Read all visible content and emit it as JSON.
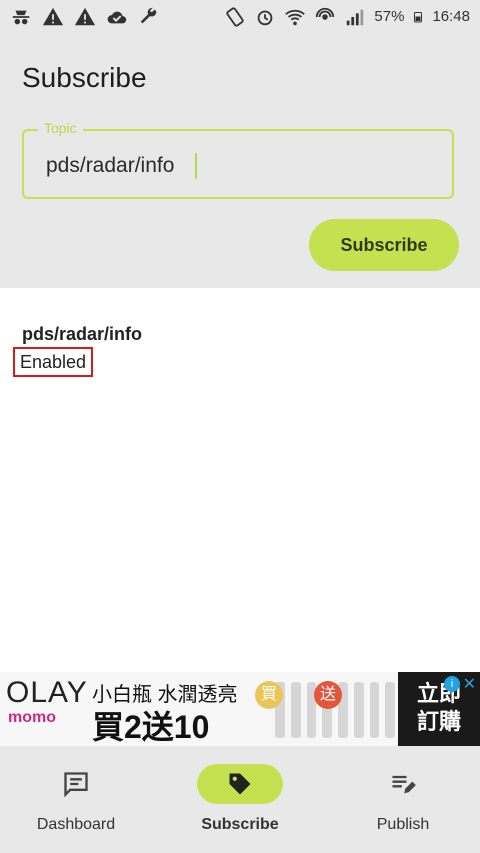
{
  "status_bar": {
    "battery": "57%",
    "time": "16:48",
    "icons_left": [
      "incognito-icon",
      "warning-icon",
      "warning-icon",
      "cloud-check-icon",
      "wrench-icon"
    ],
    "icons_right": [
      "rotate-icon",
      "alarm-icon",
      "wifi-icon",
      "hotspot-icon",
      "signal-icon",
      "battery-icon"
    ]
  },
  "header": {
    "title": "Subscribe",
    "topic_label": "Topic",
    "topic_value": "pds/radar/info",
    "subscribe_button": "Subscribe"
  },
  "subscriptions": [
    {
      "topic": "pds/radar/info",
      "status": "Enabled"
    }
  ],
  "ad": {
    "brand": "OLAY",
    "sub_brand": "momo",
    "line1": "小白瓶 水潤透亮",
    "line2": "買2送10",
    "badge_buy": "買",
    "badge_give": "送",
    "cta": "立即\n訂購"
  },
  "bottom_nav": {
    "items": [
      {
        "label": "Dashboard",
        "icon": "dashboard-icon",
        "active": false
      },
      {
        "label": "Subscribe",
        "icon": "tag-icon",
        "active": true
      },
      {
        "label": "Publish",
        "icon": "publish-icon",
        "active": false
      }
    ]
  },
  "colors": {
    "accent": "#c6e150",
    "surface": "#e8e8e8",
    "highlight_border": "#d31d1d"
  }
}
